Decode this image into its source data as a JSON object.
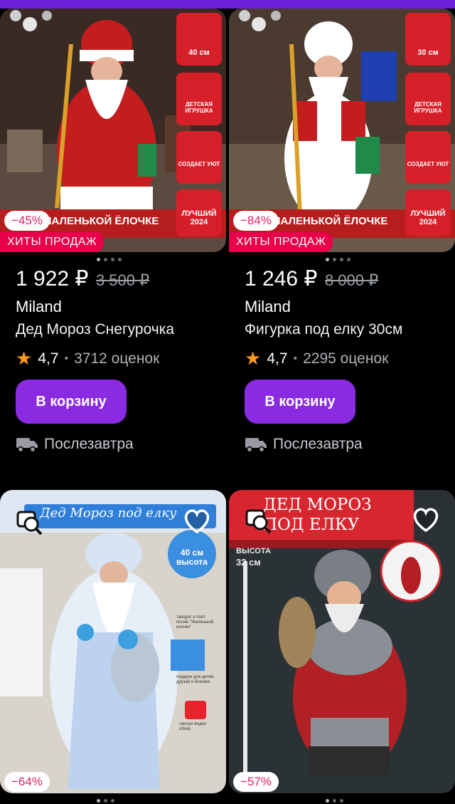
{
  "cards": [
    {
      "discount": "−45%",
      "badge": "ХИТЫ ПРОДАЖ",
      "banner_text": "МАЛЕНЬКОЙ ЁЛОЧКЕ",
      "side_badges": [
        "40 см",
        "ДЕТСКАЯ ИГРУШКА",
        "СОЗДАЕТ УЮТ",
        "ЛУЧШИЙ 2024"
      ],
      "price": "1 922 ₽",
      "old_price": "3 500 ₽",
      "brand": "Miland",
      "title": "Дед Мороз Снегурочка",
      "rating": "4,7",
      "reviews": "3712 оценок",
      "cart_button": "В корзину",
      "delivery": "Послезавтра"
    },
    {
      "discount": "−84%",
      "badge": "ХИТЫ ПРОДАЖ",
      "banner_text": "МАЛЕНЬКОЙ ЁЛОЧКЕ",
      "side_badges": [
        "30 см",
        "ДЕТСКАЯ ИГРУШКА",
        "СОЗДАЕТ УЮТ",
        "ЛУЧШИЙ 2024"
      ],
      "price": "1 246 ₽",
      "old_price": "8 000 ₽",
      "brand": "Miland",
      "title": "Фигурка под елку 30см",
      "rating": "4,7",
      "reviews": "2295 оценок",
      "cart_button": "В корзину",
      "delivery": "Послезавтра"
    },
    {
      "discount": "−64%",
      "banner_text": "Дед Мороз под елку",
      "height_badge": "40 см высота",
      "features": [
        "танцует и поет песню \"Маленькой елочке\"",
        "подарок для детей, друзей и близких",
        "смотри видео обзор"
      ]
    },
    {
      "discount": "−57%",
      "banner_line1": "ДЕД МОРОЗ",
      "banner_line2": "ПОД ЕЛКУ",
      "height_label": "ВЫСОТА",
      "height_value": "32 см"
    }
  ],
  "colors": {
    "accent": "#8a2be2",
    "topbar": "#6a1fd8",
    "discount_text": "#e0245e",
    "hit_badge": "#e8004a",
    "star": "#ff9b22"
  }
}
